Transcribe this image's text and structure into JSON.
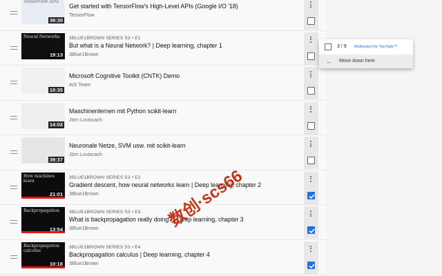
{
  "videos": [
    {
      "series": "",
      "title": "Get started with TensorFlow's High-Level APIs (Google I/O '18)",
      "channel": "TensorFlow",
      "duration": "39:30",
      "checked": false,
      "watched_progress": 0,
      "thumb_color": "#e8edf3",
      "thumb_text": "TensorFlow APIs"
    },
    {
      "series": "3BLUE1BROWN SERIES  S3 • E1",
      "title": "But what is a Neural Network? | Deep learning, chapter 1",
      "channel": "3Blue1Brown",
      "duration": "19:13",
      "checked": false,
      "watched_progress": 0,
      "thumb_color": "#101010",
      "thumb_text": "Neural Networks"
    },
    {
      "series": "",
      "title": "Microsoft Cognitive Toolkit (CNTK) Demo",
      "channel": "AIS Team",
      "duration": "10:35",
      "checked": false,
      "watched_progress": 0,
      "thumb_color": "#f0f0f0",
      "thumb_text": ""
    },
    {
      "series": "",
      "title": "Maschinenlernen mit Python scikit-learn",
      "channel": "Jörn Loviscach",
      "duration": "14:02",
      "checked": false,
      "watched_progress": 0,
      "thumb_color": "#eeeeee",
      "thumb_text": ""
    },
    {
      "series": "",
      "title": "Neuronale Netze, SVM usw. mit scikit-learn",
      "channel": "Jörn Loviscach",
      "duration": "39:37",
      "checked": false,
      "watched_progress": 0,
      "thumb_color": "#e6e6e6",
      "thumb_text": ""
    },
    {
      "series": "3BLUE1BROWN SERIES  S3 • E2",
      "title": "Gradient descent, how neural networks learn | Deep learning, chapter 2",
      "channel": "3Blue1Brown",
      "duration": "21:01",
      "checked": true,
      "watched_progress": 1.0,
      "thumb_color": "#0c0c0c",
      "thumb_text": "How machines learn"
    },
    {
      "series": "3BLUE1BROWN SERIES  S3 • E3",
      "title": "What is backpropagation really doing? | Deep learning, chapter 3",
      "channel": "3Blue1Brown",
      "duration": "13:54",
      "checked": true,
      "watched_progress": 1.0,
      "thumb_color": "#0c0c0c",
      "thumb_text": "Backpropagation"
    },
    {
      "series": "3BLUE1BROWN SERIES  S3 • E4",
      "title": "Backpropagation calculus | Deep learning, chapter 4",
      "channel": "3Blue1Brown",
      "duration": "10:18",
      "checked": true,
      "watched_progress": 1.0,
      "thumb_color": "#0c0c0c",
      "thumb_text": "Backpropagation calculus"
    }
  ],
  "popup": {
    "count": "3 / 9",
    "extension": "Multiselect for YouTube™",
    "move_label": "Move down here",
    "back_icon": "arrow-left-icon"
  },
  "watermark": "数创·scs66",
  "colors": {
    "accent": "#1a73e8",
    "progress": "#ee1111"
  }
}
